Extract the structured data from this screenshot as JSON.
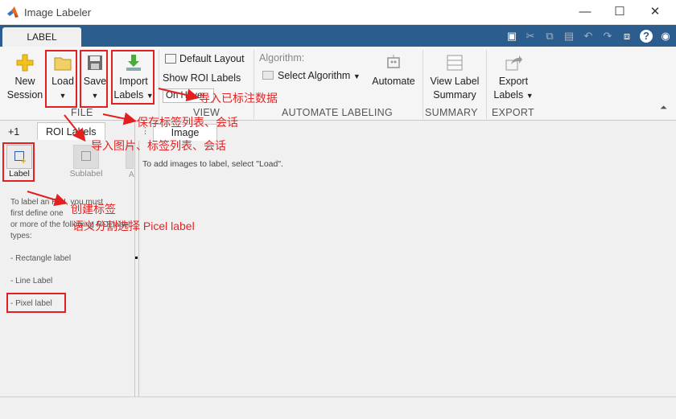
{
  "window": {
    "title": "Image Labeler",
    "controls": {
      "minimize": "—",
      "maximize": "☐",
      "close": "✕"
    }
  },
  "ribbon_tab": "LABEL",
  "file": {
    "new_session": [
      "New",
      "Session"
    ],
    "load": "Load",
    "save": "Save",
    "import_labels": [
      "Import",
      "Labels"
    ],
    "section": "FILE"
  },
  "view": {
    "default_layout": "Default Layout",
    "show_roi_labels": "Show ROI Labels",
    "on_hover": "On Hover",
    "section": "VIEW"
  },
  "automate": {
    "algorithm_label": "Algorithm:",
    "select_algorithm": "Select Algorithm",
    "automate": "Automate",
    "section": "AUTOMATE LABELING"
  },
  "summary": {
    "view_label_summary": [
      "View Label",
      "Summary"
    ],
    "section": "SUMMARY"
  },
  "export": {
    "export_labels": [
      "Export",
      "Labels"
    ],
    "section": "EXPORT"
  },
  "left_panel": {
    "tabs": [
      "+1",
      "ROI Labels"
    ],
    "tools": {
      "label": "Label",
      "sublabel": "Sublabel",
      "partial": "A"
    },
    "help_lines": [
      "To label an ROI, you must",
      "first define one",
      "or more of the following ROI label",
      "types:"
    ],
    "types": [
      "- Rectangle label",
      "- Line Label",
      "- Pixel label"
    ]
  },
  "image_panel": {
    "tab": "Image",
    "message": "To add images to label, select \"Load\"."
  },
  "annotations": {
    "import_labeled": "导入已标注数据",
    "save_lists": "保存标签列表、会话",
    "import_images": "导入图片、标签列表、会话",
    "create_label": "创建标签",
    "pixel_label_note": "语义分割选择 Picel label"
  },
  "colors": {
    "accent": "#2c5d8f",
    "annotation_red": "#e32020"
  }
}
